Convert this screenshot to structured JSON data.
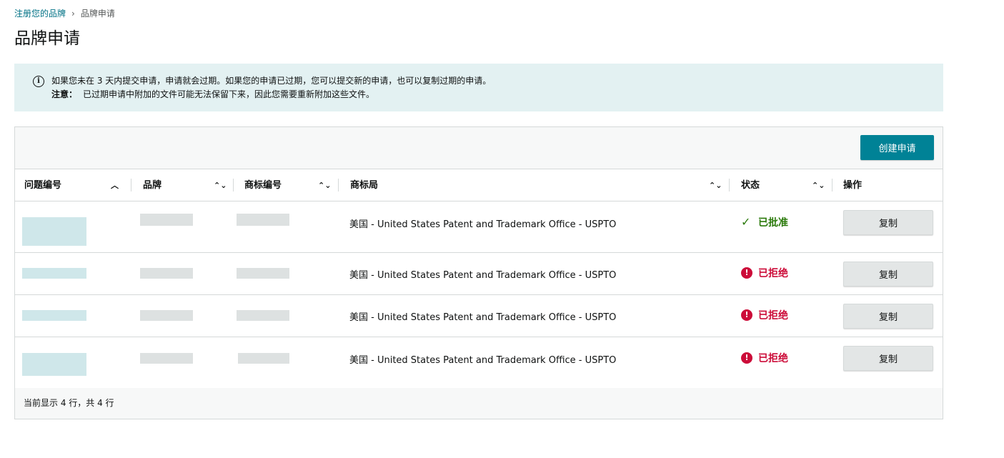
{
  "breadcrumb": {
    "parent": "注册您的品牌",
    "separator": "›",
    "current": "品牌申请"
  },
  "page_title": "品牌申请",
  "info": {
    "line1": "如果您未在 3 天内提交申请，申请就会过期。如果您的申请已过期，您可以提交新的申请，也可以复制过期的申请。",
    "note_label": "注意：",
    "note_text": "已过期申请中附加的文件可能无法保留下来，因此您需要重新附加这些文件。"
  },
  "toolbar": {
    "create_label": "创建申请"
  },
  "columns": [
    {
      "label": "问题编号",
      "sort_icon": "chevron-up"
    },
    {
      "label": "品牌",
      "sort_icon": "sort-updown"
    },
    {
      "label": "商标编号",
      "sort_icon": "sort-updown"
    },
    {
      "label": "商标局",
      "sort_icon": "sort-updown"
    },
    {
      "label": "状态",
      "sort_icon": "sort-updown"
    },
    {
      "label": "操作"
    }
  ],
  "rows": [
    {
      "office": "美国 - United States Patent and Trademark Office - USPTO",
      "status": "已批准",
      "status_type": "approved",
      "action": "复制"
    },
    {
      "office": "美国 - United States Patent and Trademark Office - USPTO",
      "status": "已拒绝",
      "status_type": "rejected",
      "action": "复制"
    },
    {
      "office": "美国 - United States Patent and Trademark Office - USPTO",
      "status": "已拒绝",
      "status_type": "rejected",
      "action": "复制"
    },
    {
      "office": "美国 - United States Patent and Trademark Office - USPTO",
      "status": "已拒绝",
      "status_type": "rejected",
      "action": "复制"
    }
  ],
  "footer": {
    "summary": "当前显示 4 行，共 4 行"
  },
  "colors": {
    "accent": "#008296",
    "approved": "#2b7a0b",
    "rejected": "#cc0c39",
    "info_bg": "#e3f1f2"
  }
}
